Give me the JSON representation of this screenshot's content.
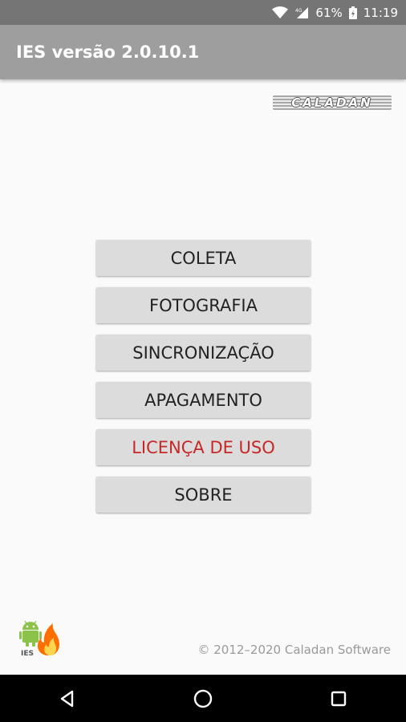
{
  "status_bar": {
    "battery_percent": "61%",
    "time": "11:19",
    "network_label": "4G",
    "icons": [
      "wifi-icon",
      "cell-signal-icon",
      "battery-icon"
    ]
  },
  "app_bar": {
    "title": "IES versão 2.0.10.1"
  },
  "logo": {
    "text": "CALADAN"
  },
  "menu": {
    "buttons": [
      {
        "label": "COLETA"
      },
      {
        "label": "FOTOGRAFIA"
      },
      {
        "label": "SINCRONIZAÇÃO"
      },
      {
        "label": "APAGAMENTO"
      },
      {
        "label": "LICENÇA DE USO",
        "color": "#c62828"
      },
      {
        "label": "SOBRE"
      }
    ]
  },
  "footer": {
    "copyright": "© 2012–2020 Caladan Software",
    "app_icon_text": "IES"
  },
  "nav_bar": {
    "icons": [
      "back-icon",
      "home-icon",
      "recents-icon"
    ]
  },
  "colors": {
    "status_bar": "#757575",
    "app_bar": "#9e9e9e",
    "button_bg": "#dcdcdc",
    "accent_red": "#c62828"
  }
}
